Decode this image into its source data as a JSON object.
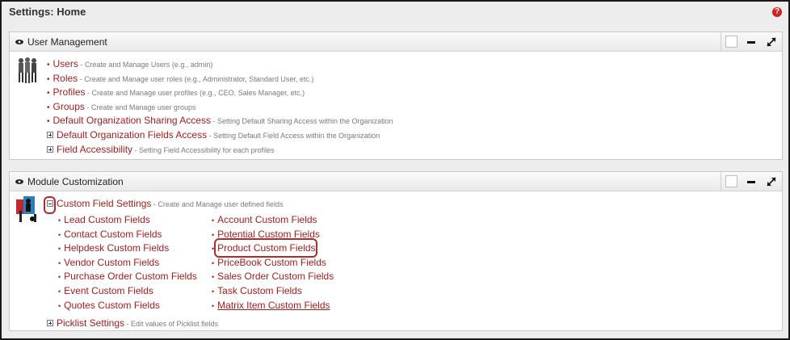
{
  "header": {
    "title": "Settings: Home",
    "help_symbol": "?"
  },
  "icons": {
    "help": "help-icon",
    "eye": "eye-icon",
    "restore": "restore-icon",
    "minimize": "minimize-icon",
    "maximize": "expand-arrows-icon"
  },
  "colors": {
    "link": "#a51d1d",
    "highlight": "#b22a2a"
  },
  "user_management": {
    "title": "User Management",
    "items": [
      {
        "label": "Users",
        "desc": " - Create and Manage Users (e.g., admin)"
      },
      {
        "label": "Roles",
        "desc": " - Create and Manage user roles (e.g., Administrator, Standard User, etc.)"
      },
      {
        "label": "Profiles",
        "desc": " - Create and Manage user profiles (e.g., CEO, Sales Manager, etc.)"
      },
      {
        "label": "Groups",
        "desc": " - Create and Manage user groups"
      },
      {
        "label": "Default Organization Sharing Access",
        "desc": " - Setting Default Sharing Access within the Organization"
      },
      {
        "label": "Default Organization Fields Access",
        "desc": " - Setting Default Field Access within the Organization"
      },
      {
        "label": "Field Accessibility",
        "desc": " - Setting Field Accessibility for each profiles"
      }
    ]
  },
  "module_customization": {
    "title": "Module Customization",
    "custom_field_settings": {
      "label": "Custom Field Settings",
      "desc": " - Create and Manage user defined fields"
    },
    "left_links": [
      "Lead Custom Fields",
      "Contact Custom Fields",
      "Helpdesk Custom Fields",
      "Vendor Custom Fields",
      "Purchase Order Custom Fields",
      "Event Custom Fields",
      "Quotes Custom Fields"
    ],
    "right_links": [
      "Account Custom Fields",
      "Potential Custom Fields",
      "Product Custom Fields",
      "PriceBook Custom Fields",
      "Sales Order Custom Fields",
      "Task Custom Fields",
      "Matrix Item Custom Fields"
    ],
    "picklist_settings": {
      "label": "Picklist Settings",
      "desc": " - Edit values of Picklist fields"
    }
  }
}
